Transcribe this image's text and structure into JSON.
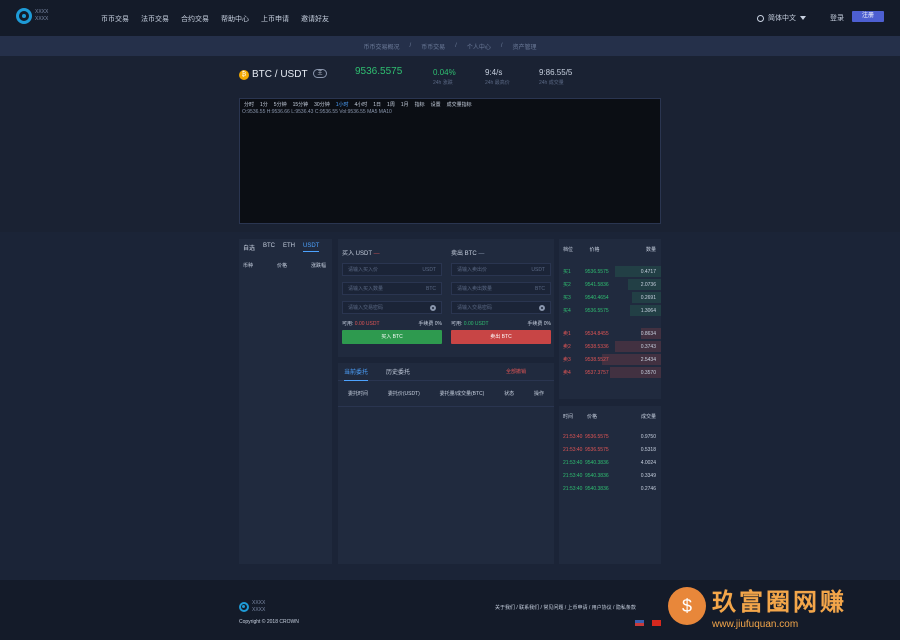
{
  "brand": {
    "logo_line1": "XXXX",
    "logo_line2": "XXXX"
  },
  "nav": {
    "items": [
      "币币交易",
      "法币交易",
      "合约交易",
      "帮助中心",
      "上币申请",
      "邀请好友"
    ]
  },
  "header": {
    "language": "简体中文",
    "login": "登录",
    "register": "注册"
  },
  "breadcrumb": [
    "币币交易概况",
    "币币交易",
    "个人中心",
    "资产管理"
  ],
  "ticker": {
    "pair": "BTC / USDT",
    "tag": "主",
    "price": "9536.5575",
    "stats": [
      {
        "value": "0.04%",
        "label": "24h 涨跌"
      },
      {
        "value": "9:4/s",
        "label": "24h 最高价"
      },
      {
        "value": "9:86.55/5",
        "label": "24h 成交量"
      }
    ]
  },
  "chart": {
    "toolbar": [
      "分时",
      "1分",
      "5分钟",
      "15分钟",
      "30分钟",
      "1小时",
      "4小时",
      "1日",
      "1周",
      "1月",
      "指标",
      "设置"
    ],
    "active": "1小时",
    "indicator": "成交量指标",
    "legend": "O:9536.55 H:9536.66 L:9536.43 C:9536.55 Vol:9536.55 MA5 MA10"
  },
  "coinlist": {
    "tabs": [
      "自选",
      "BTC",
      "ETH",
      "USDT"
    ],
    "active_tab": "USDT",
    "headers": [
      "币种",
      "价格",
      "涨跌幅"
    ]
  },
  "trade": {
    "buy": {
      "title": "买入 USDT",
      "dash": "—",
      "price_placeholder": "请输入买入价",
      "price_unit": "USDT",
      "amount_placeholder": "请输入买入数量",
      "amount_unit": "BTC",
      "pwd_placeholder": "请输入交易密码",
      "avail_label": "可用:",
      "avail_value": "0.00 USDT",
      "fee": "手续费 0%",
      "button": "买入 BTC"
    },
    "sell": {
      "title": "卖出 BTC",
      "dash": "—",
      "price_placeholder": "请输入卖出价",
      "price_unit": "USDT",
      "amount_placeholder": "请输入卖出数量",
      "amount_unit": "BTC",
      "pwd_placeholder": "请输入交易密码",
      "avail_label": "可用:",
      "avail_value": "0.00 USDT",
      "fee": "手续费 0%",
      "button": "卖出 BTC"
    }
  },
  "orders": {
    "tabs": [
      "当前委托",
      "历史委托"
    ],
    "active_tab": "当前委托",
    "cancel_all": "全部撤销",
    "headers": [
      "委托时间",
      "委托价(USDT)",
      "委托量/成交量(BTC)",
      "状态",
      "操作"
    ]
  },
  "orderbook": {
    "headers": [
      "档位",
      "价格",
      "数量"
    ],
    "buys": [
      {
        "level": "买1",
        "price": "9536.5575",
        "qty": "0.4717",
        "depth": 0.45
      },
      {
        "level": "买2",
        "price": "9541.5836",
        "qty": "2.0736",
        "depth": 0.32
      },
      {
        "level": "买3",
        "price": "9540.4654",
        "qty": "0.2691",
        "depth": 0.28
      },
      {
        "level": "买4",
        "price": "9536.5575",
        "qty": "1.3064",
        "depth": 0.3
      }
    ],
    "sells": [
      {
        "level": "卖1",
        "price": "9534.8455",
        "qty": "0.8634",
        "depth": 0.2
      },
      {
        "level": "卖2",
        "price": "9538.5336",
        "qty": "0.3743",
        "depth": 0.45
      },
      {
        "level": "卖3",
        "price": "9538.5527",
        "qty": "2.5434",
        "depth": 0.58
      },
      {
        "level": "卖4",
        "price": "9537.3757",
        "qty": "0.3570",
        "depth": 0.5
      }
    ]
  },
  "deals": {
    "headers": [
      "时间",
      "价格",
      "成交量"
    ],
    "rows": [
      {
        "time": "21:53:40",
        "price": "9536.5575",
        "qty": "0.9750",
        "side": "sell"
      },
      {
        "time": "21:53:40",
        "price": "9536.5575",
        "qty": "0.5318",
        "side": "sell"
      },
      {
        "time": "21:53:40",
        "price": "9540.3836",
        "qty": "4.0024",
        "side": "buy"
      },
      {
        "time": "21:53:40",
        "price": "9540.3836",
        "qty": "0.3349",
        "side": "buy"
      },
      {
        "time": "21:53:40",
        "price": "9540.3836",
        "qty": "0.2746",
        "side": "buy"
      }
    ]
  },
  "footer": {
    "copyright": "Copyright © 2018 CROWN",
    "links": "关于我们 / 联系我们 / 常见问题 / 上币申请 / 用户协议 / 隐私条款"
  },
  "watermark": {
    "title": "玖富圈网赚",
    "url": "www.jiufuquan.com",
    "icon": "$"
  },
  "colors": {
    "green": "#2fbf71",
    "red": "#e05555",
    "accent": "#4da3ff",
    "button_buy": "#2e9a4f",
    "button_sell": "#c84545",
    "register": "#4d5fd1"
  }
}
